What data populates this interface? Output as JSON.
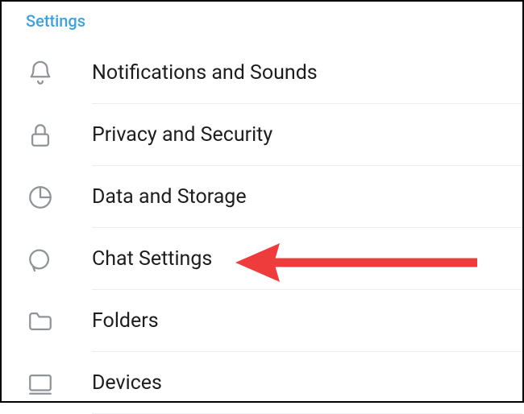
{
  "header": {
    "title": "Settings"
  },
  "items": [
    {
      "label": "Notifications and Sounds",
      "icon": "bell"
    },
    {
      "label": "Privacy and Security",
      "icon": "lock"
    },
    {
      "label": "Data and Storage",
      "icon": "pie-chart"
    },
    {
      "label": "Chat Settings",
      "icon": "chat-bubble"
    },
    {
      "label": "Folders",
      "icon": "folder"
    },
    {
      "label": "Devices",
      "icon": "device"
    }
  ],
  "annotation": {
    "target_index": 3,
    "color": "#ee3b3b"
  }
}
